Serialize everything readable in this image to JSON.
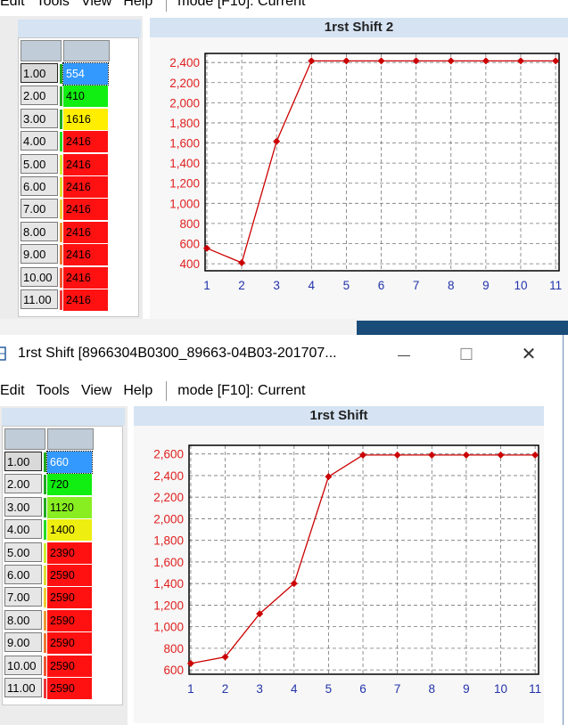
{
  "top_window": {
    "menu": {
      "items": [
        "Edit",
        "Tools",
        "View",
        "Help"
      ],
      "mode_text": "mode [F10]: Current"
    },
    "title": "1rst Shift 2",
    "table": {
      "rows": [
        {
          "label": "1.00",
          "value": "554",
          "color": "#3399ff",
          "marker": "#22aa22"
        },
        {
          "label": "2.00",
          "value": "410",
          "color": "#11ee11",
          "marker": "#22aa22"
        },
        {
          "label": "3.00",
          "value": "1616",
          "color": "#ffee00",
          "marker": "#22aa22"
        },
        {
          "label": "4.00",
          "value": "2416",
          "color": "#ff1111",
          "marker": "#22dd22"
        },
        {
          "label": "5.00",
          "value": "2416",
          "color": "#ff1111",
          "marker": "#ccee33"
        },
        {
          "label": "6.00",
          "value": "2416",
          "color": "#ff1111",
          "marker": "#dddd33"
        },
        {
          "label": "7.00",
          "value": "2416",
          "color": "#ff1111",
          "marker": "#eecc33"
        },
        {
          "label": "8.00",
          "value": "2416",
          "color": "#ff1111",
          "marker": "#ee9933"
        },
        {
          "label": "9.00",
          "value": "2416",
          "color": "#ff1111",
          "marker": "#ee7733"
        },
        {
          "label": "10.00",
          "value": "2416",
          "color": "#ff1111",
          "marker": "#ee5533"
        },
        {
          "label": "11.00",
          "value": "2416",
          "color": "#ff1111",
          "marker": "#ee3333"
        }
      ]
    }
  },
  "bottom_window": {
    "window_title": "1rst Shift  [8966304B0300_89663-04B03-201707...",
    "controls": {
      "minimize": "—",
      "maximize": "☐",
      "close": "✕"
    },
    "menu": {
      "items": [
        "Edit",
        "Tools",
        "View",
        "Help"
      ],
      "mode_text": "mode [F10]: Current"
    },
    "title": "1rst Shift",
    "table": {
      "rows": [
        {
          "label": "1.00",
          "value": "660",
          "color": "#3399ff",
          "marker": "#22aa22"
        },
        {
          "label": "2.00",
          "value": "720",
          "color": "#11ee11",
          "marker": "#22aa22"
        },
        {
          "label": "3.00",
          "value": "1120",
          "color": "#88ee22",
          "marker": "#22aa22"
        },
        {
          "label": "4.00",
          "value": "1400",
          "color": "#eeee11",
          "marker": "#22dd22"
        },
        {
          "label": "5.00",
          "value": "2390",
          "color": "#ff1111",
          "marker": "#ccee33"
        },
        {
          "label": "6.00",
          "value": "2590",
          "color": "#ff1111",
          "marker": "#dddd33"
        },
        {
          "label": "7.00",
          "value": "2590",
          "color": "#ff1111",
          "marker": "#eecc33"
        },
        {
          "label": "8.00",
          "value": "2590",
          "color": "#ff1111",
          "marker": "#ee9933"
        },
        {
          "label": "9.00",
          "value": "2590",
          "color": "#ff1111",
          "marker": "#ee7733"
        },
        {
          "label": "10.00",
          "value": "2590",
          "color": "#ff1111",
          "marker": "#ee5533"
        },
        {
          "label": "11.00",
          "value": "2590",
          "color": "#ff1111",
          "marker": "#ee3333"
        }
      ]
    }
  },
  "chart_data": [
    {
      "type": "line",
      "title": "1rst Shift 2",
      "x": [
        1,
        2,
        3,
        4,
        5,
        6,
        7,
        8,
        9,
        10,
        11
      ],
      "series": [
        {
          "values": [
            554,
            410,
            1616,
            2416,
            2416,
            2416,
            2416,
            2416,
            2416,
            2416,
            2416
          ],
          "color": "#cc0000"
        }
      ],
      "yticks": [
        400,
        600,
        800,
        1000,
        1200,
        1400,
        1600,
        1800,
        2000,
        2200,
        2400
      ],
      "ytick_labels": [
        "400",
        "600",
        "800",
        "1,000",
        "1,200",
        "1,400",
        "1,600",
        "1,800",
        "2,000",
        "2,200",
        "2,400"
      ],
      "ylim": [
        330,
        2490
      ],
      "xlim": [
        0.95,
        11.1
      ],
      "grid": true
    },
    {
      "type": "line",
      "title": "1rst Shift",
      "x": [
        1,
        2,
        3,
        4,
        5,
        6,
        7,
        8,
        9,
        10,
        11
      ],
      "series": [
        {
          "values": [
            660,
            720,
            1120,
            1400,
            2390,
            2590,
            2590,
            2590,
            2590,
            2590,
            2590
          ],
          "color": "#cc0000"
        }
      ],
      "yticks": [
        600,
        800,
        1000,
        1200,
        1400,
        1600,
        1800,
        2000,
        2200,
        2400,
        2600
      ],
      "ytick_labels": [
        "600",
        "800",
        "1,000",
        "1,200",
        "1,400",
        "1,600",
        "1,800",
        "2,000",
        "2,200",
        "2,400",
        "2,600"
      ],
      "ylim": [
        560,
        2680
      ],
      "xlim": [
        0.95,
        11.1
      ],
      "grid": true
    }
  ]
}
